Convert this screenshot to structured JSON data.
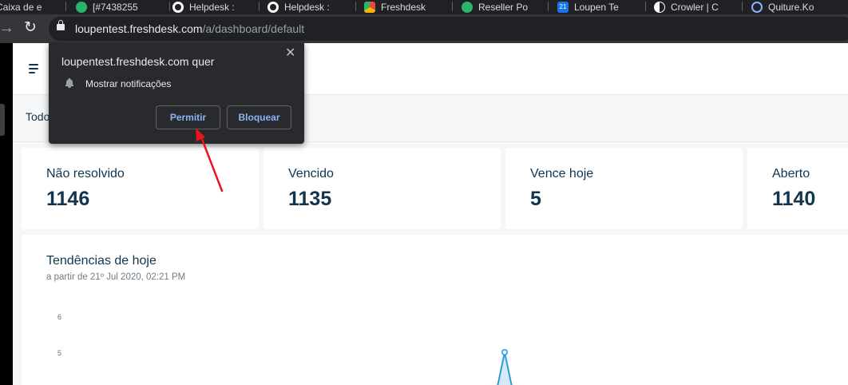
{
  "browser": {
    "tabs": [
      {
        "label": "Caixa de e",
        "icon": "gmail-icon"
      },
      {
        "label": "[#7438255",
        "icon": "freshdesk-green-icon"
      },
      {
        "label": "Helpdesk :",
        "icon": "ring-icon"
      },
      {
        "label": "Helpdesk :",
        "icon": "ring-icon"
      },
      {
        "label": "Freshdesk",
        "icon": "freshworks-icon"
      },
      {
        "label": "Reseller Po",
        "icon": "freshdesk-green-icon"
      },
      {
        "label": "Loupen Te",
        "icon": "calendar-icon",
        "badge": "21"
      },
      {
        "label": "Crowler | C",
        "icon": "crowler-icon"
      },
      {
        "label": "Quiture.Ko",
        "icon": "swirl-icon"
      }
    ],
    "url_host": "loupentest.freshdesk.com",
    "url_path": "/a/dashboard/default"
  },
  "popup": {
    "title": "loupentest.freshdesk.com quer",
    "permission": "Mostrar notificações",
    "allow_label": "Permitir",
    "block_label": "Bloquear",
    "close_glyph": "✕"
  },
  "filterbar": {
    "label": "Todo"
  },
  "cards": [
    {
      "title": "Não resolvido",
      "value": "1146"
    },
    {
      "title": "Vencido",
      "value": "1135"
    },
    {
      "title": "Vence hoje",
      "value": "5"
    },
    {
      "title": "Aberto",
      "value": "1140"
    }
  ],
  "trend": {
    "title": "Tendências de hoje",
    "subtitle": "a partir de 21º Jul 2020, 02:21 PM"
  },
  "chart_data": {
    "type": "line",
    "title": "Tendências de hoje",
    "y_ticks": [
      "6",
      "5"
    ],
    "peak_value": 5,
    "color": "#2c9cdb"
  },
  "annotation": {
    "arrow_color": "#e8141c"
  }
}
